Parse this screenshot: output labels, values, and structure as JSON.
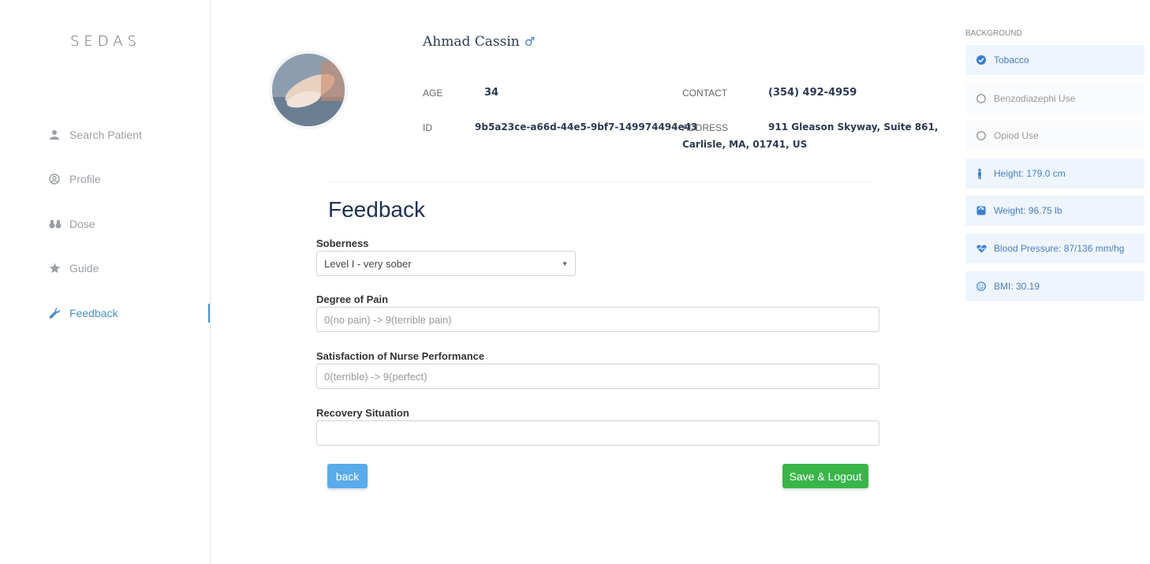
{
  "sidebar": {
    "brand": "SEDAS",
    "items": [
      {
        "label": "Search Patient"
      },
      {
        "label": "Profile"
      },
      {
        "label": "Dose"
      },
      {
        "label": "Guide"
      },
      {
        "label": "Feedback"
      }
    ]
  },
  "patient": {
    "name": "Ahmad Cassin",
    "gender_symbol": "♂",
    "age_label": "AGE",
    "age": "34",
    "id_label": "ID",
    "id": "9b5a23ce-a66d-44e5-9bf7-149974494e43",
    "contact_label": "CONTACT",
    "contact": "(354) 492-4959",
    "address_label": "ADDRESS",
    "address_line1": "911 Gleason Skyway, Suite 861,",
    "address_line2": "Carlisle, MA, 01741, US"
  },
  "form": {
    "title": "Feedback",
    "soberness_label": "Soberness",
    "soberness_value": "Level I - very sober",
    "pain_label": "Degree of Pain",
    "pain_placeholder": "0(no pain) -> 9(terrible pain)",
    "nurse_label": "Satisfaction of Nurse Performance",
    "nurse_placeholder": "0(terrible) -> 9(perfect)",
    "recovery_label": "Recovery Situation",
    "recovery_value": "",
    "back_label": "back",
    "save_label": "Save & Logout"
  },
  "background": {
    "title": "BACKGROUND",
    "items": [
      {
        "label": "Tobacco",
        "checked": true
      },
      {
        "label": "Benzodiazephi Use",
        "checked": false
      },
      {
        "label": "Opiod Use",
        "checked": false
      },
      {
        "label": "Height: 179.0 cm"
      },
      {
        "label": "Weight: 96.75 lb"
      },
      {
        "label": "Blood Pressure: 87/136 mm/hg"
      },
      {
        "label": "BMI: 30.19"
      }
    ]
  },
  "colors": {
    "accent": "#4a90c9",
    "save": "#39b54a",
    "back": "#5aabea"
  }
}
